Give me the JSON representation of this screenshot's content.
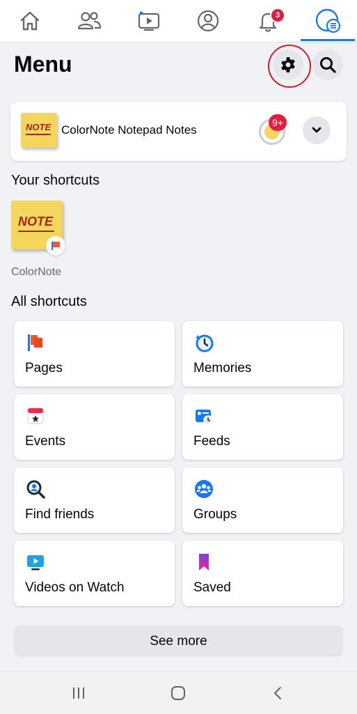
{
  "nav": {
    "tabs": [
      {
        "icon": "home-icon"
      },
      {
        "icon": "friends-icon"
      },
      {
        "icon": "watch-icon"
      },
      {
        "icon": "profile-icon"
      },
      {
        "icon": "notifications-icon",
        "badge": "3"
      },
      {
        "icon": "menu-icon",
        "active": true
      }
    ],
    "accent": "#1877f2"
  },
  "header": {
    "title": "Menu",
    "settings_icon": "gear-icon",
    "search_icon": "search-icon"
  },
  "profile_card": {
    "name": "ColorNote Notepad Notes",
    "thumb_text": "NOTE",
    "story_badge": "9+",
    "expand_icon": "chevron-down-icon"
  },
  "your_shortcuts": {
    "title": "Your shortcuts",
    "items": [
      {
        "label": "ColorNote",
        "thumb_text": "NOTE",
        "badge_icon": "flag-icon"
      }
    ]
  },
  "all_shortcuts": {
    "title": "All shortcuts",
    "tiles": [
      {
        "label": "Pages",
        "icon": "pages-flag-icon"
      },
      {
        "label": "Memories",
        "icon": "memories-clock-icon"
      },
      {
        "label": "Events",
        "icon": "events-calendar-icon"
      },
      {
        "label": "Feeds",
        "icon": "feeds-icon"
      },
      {
        "label": "Find friends",
        "icon": "find-friends-icon"
      },
      {
        "label": "Groups",
        "icon": "groups-icon"
      },
      {
        "label": "Videos on Watch",
        "icon": "watch-video-icon"
      },
      {
        "label": "Saved",
        "icon": "saved-bookmark-icon"
      }
    ]
  },
  "see_more": {
    "label": "See more"
  },
  "system_nav": {
    "buttons": [
      "recents-icon",
      "home-button-icon",
      "back-icon"
    ]
  },
  "colors": {
    "background": "#f0f2f5",
    "badge_red": "#e41e3f",
    "highlight_ring": "#d11a2a"
  }
}
